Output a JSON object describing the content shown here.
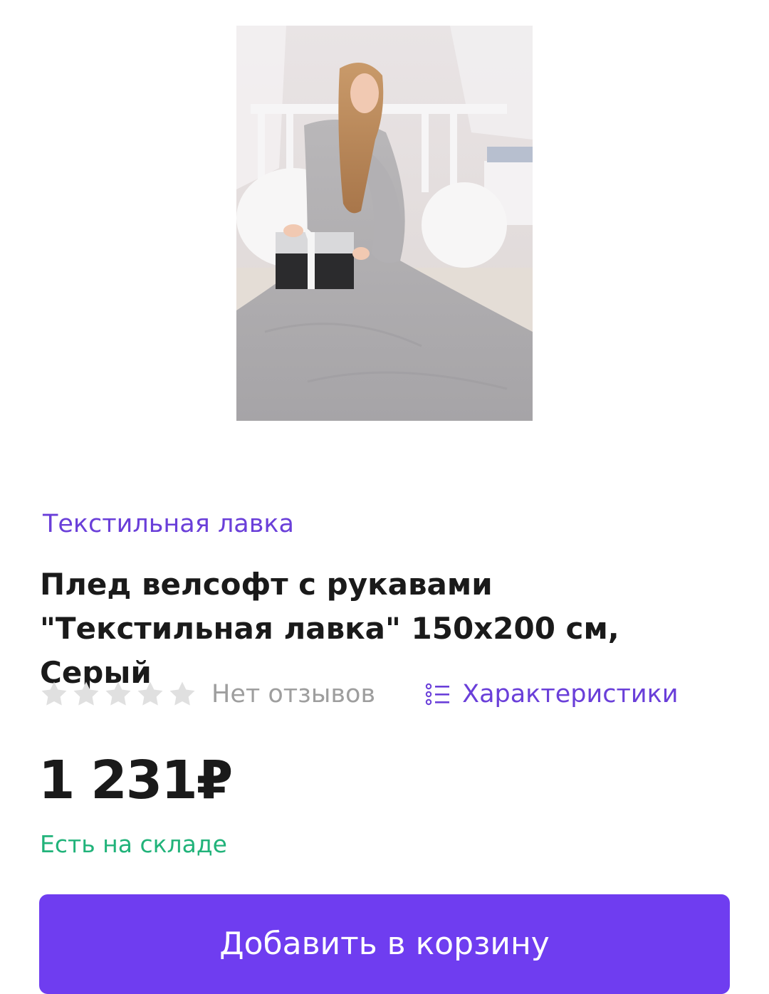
{
  "product": {
    "seller": "Текстильная лавка",
    "title": "Плед велсофт с рукавами \"Текстильная лавка\" 150х200 см, Серый",
    "rating": {
      "stars_filled": 0,
      "stars_total": 5,
      "reviews_text": "Нет отзывов"
    },
    "specs_link": "Характеристики",
    "price": "1 231₽",
    "stock_status": "Есть на складе",
    "add_to_cart": "Добавить в корзину"
  },
  "colors": {
    "accent": "#6f3df0",
    "link": "#6a3fd9",
    "in_stock": "#21b37a",
    "star_empty": "#e0e0e0"
  },
  "icons": {
    "star": "star-icon",
    "specs": "list-icon"
  }
}
